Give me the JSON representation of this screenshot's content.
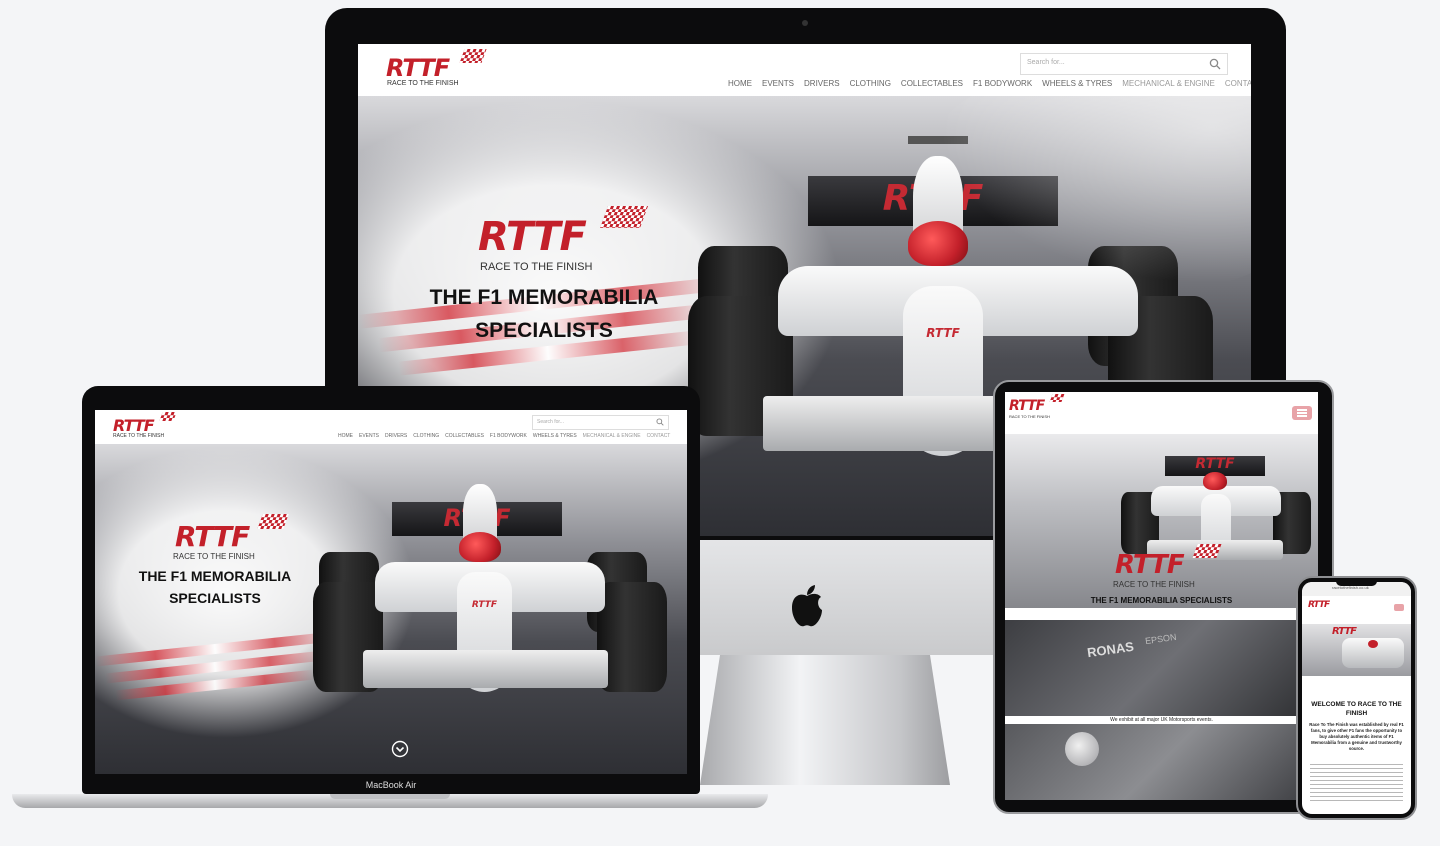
{
  "brand": {
    "logo_text": "RTTF",
    "tagline": "RACE TO THE FINISH",
    "hero_title_line1": "THE F1 MEMORABILIA",
    "hero_title_line2": "SPECIALISTS",
    "hero_title_single": "THE F1 MEMORABILIA SPECIALISTS"
  },
  "search": {
    "placeholder": "Search for...",
    "icon": "search-icon"
  },
  "nav": {
    "items": [
      {
        "label": "HOME"
      },
      {
        "label": "EVENTS"
      },
      {
        "label": "DRIVERS"
      },
      {
        "label": "CLOTHING"
      },
      {
        "label": "COLLECTABLES"
      },
      {
        "label": "F1 BODYWORK"
      },
      {
        "label": "WHEELS & TYRES"
      },
      {
        "label": "MECHANICAL & ENGINE"
      },
      {
        "label": "CONTACT"
      }
    ]
  },
  "car": {
    "wing_text": "RTTF",
    "nose_text": "RTTF",
    "helmet_text": "RACE TO THE FINISH"
  },
  "laptop": {
    "label": "MacBook Air",
    "scroll_icon": "chevron-down-circle-icon"
  },
  "imac": {
    "logo_icon": "apple-logo-icon"
  },
  "tablet": {
    "menu_icon": "hamburger-menu-icon",
    "sponsor_1": "RONAS",
    "sponsor_2": "EPSON",
    "caption": "We exhibit at all major UK Motorsports events."
  },
  "phone": {
    "url": "racetothefinish.co.uk",
    "welcome_title": "WELCOME TO RACE TO THE FINISH",
    "intro": "Race To The Finish was established by real F1 fans, to give other F1 fans the opportunity to buy absolutely authentic items of F1 Memorabilia from a genuine and trustworthy source."
  },
  "colors": {
    "brand_red": "#c3202a",
    "background": "#f4f5f7",
    "nav_text": "#666666"
  }
}
